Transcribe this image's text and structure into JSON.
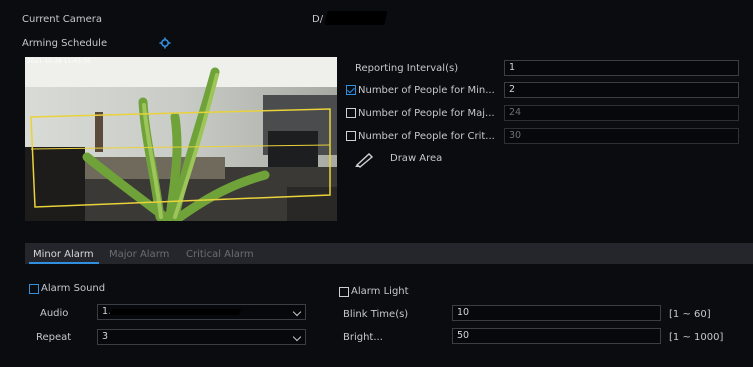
{
  "header": {
    "current_camera_label": "Current Camera",
    "camera_value": "D/",
    "arming_schedule_label": "Arming Schedule"
  },
  "preview": {
    "osd_timestamp": "2021-10-28 11:45:16"
  },
  "settings": {
    "reporting_interval_label": "Reporting Interval(s)",
    "reporting_interval_value": "1",
    "minor_label": "Number of People for Min...",
    "minor_value": "2",
    "minor_checked": true,
    "major_label": "Number of People for Maj...",
    "major_value": "24",
    "major_checked": false,
    "critical_label": "Number of People for Crit...",
    "critical_value": "30",
    "critical_checked": false,
    "draw_area_label": "Draw Area"
  },
  "tabs": [
    {
      "label": "Minor Alarm",
      "active": true
    },
    {
      "label": "Major Alarm",
      "active": false
    },
    {
      "label": "Critical Alarm",
      "active": false
    }
  ],
  "alarm": {
    "alarm_sound_label": "Alarm Sound",
    "alarm_sound_checked": false,
    "audio_label": "Audio",
    "audio_value": "1.",
    "repeat_label": "Repeat",
    "repeat_value": "3",
    "alarm_light_label": "Alarm Light",
    "alarm_light_checked": false,
    "blink_time_label": "Blink Time(s)",
    "blink_time_value": "10",
    "blink_time_range": "[1 ~ 60]",
    "bright_label": "Bright...",
    "bright_value": "50",
    "bright_range": "[1 ~ 1000]"
  },
  "colors": {
    "accent": "#2f8fe0",
    "background": "#0b0c10",
    "tab_bar": "#24262c",
    "detection_line": "#e9d23a"
  }
}
